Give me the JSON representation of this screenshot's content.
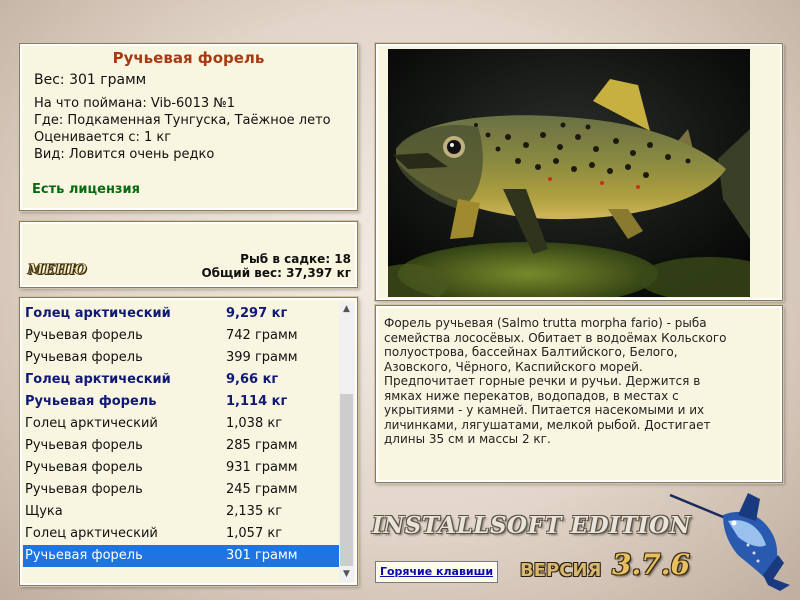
{
  "info": {
    "title": "Ручьевая форель",
    "weight": "Вес: 301 грамм",
    "caught_with": "На что поймана: Vib-6013 №1",
    "location": "Где: Подкаменная Тунгуска, Таёжное лето",
    "valued_from": "Оценивается с: 1 кг",
    "rarity": "Вид: Ловится очень редко",
    "license": "Есть лицензия"
  },
  "stats": {
    "menu_label": "МЕНЮ",
    "fish_count": "Рыб в садке: 18",
    "total_weight": "Общий вес: 37,397 кг"
  },
  "catch_list": [
    {
      "name": "Голец арктический",
      "weight": "9,297 кг",
      "highlight": true,
      "selected": false
    },
    {
      "name": "Ручьевая форель",
      "weight": "742 грамм",
      "highlight": false,
      "selected": false
    },
    {
      "name": "Ручьевая форель",
      "weight": "399 грамм",
      "highlight": false,
      "selected": false
    },
    {
      "name": "Голец арктический",
      "weight": "9,66 кг",
      "highlight": true,
      "selected": false
    },
    {
      "name": "Ручьевая форель",
      "weight": "1,114 кг",
      "highlight": true,
      "selected": false
    },
    {
      "name": "Голец арктический",
      "weight": "1,038 кг",
      "highlight": false,
      "selected": false
    },
    {
      "name": "Ручьевая форель",
      "weight": "285 грамм",
      "highlight": false,
      "selected": false
    },
    {
      "name": "Ручьевая форель",
      "weight": "931 грамм",
      "highlight": false,
      "selected": false
    },
    {
      "name": "Ручьевая форель",
      "weight": "245 грамм",
      "highlight": false,
      "selected": false
    },
    {
      "name": "Щука",
      "weight": "2,135 кг",
      "highlight": false,
      "selected": false
    },
    {
      "name": "Голец арктический",
      "weight": "1,057 кг",
      "highlight": false,
      "selected": false
    },
    {
      "name": "Ручьевая форель",
      "weight": "301 грамм",
      "highlight": false,
      "selected": true
    }
  ],
  "description": "Форель ручьевая (Salmo trutta morpha fario) - рыба семейства лососёвых. Обитает в водоёмах Кольского полуострова, бассейнах Балтийского, Белого, Азовского, Чёрного, Каспийского морей. Предпочитает горные речки и ручьи. Держится в ямках ниже перекатов, водопадов, в местах с укрытиями - у камней. Питается насекомыми и их личинками, лягушатами, мелкой рыбой. Достигает длины 35 см и массы 2 кг.",
  "footer": {
    "hotkeys_label": "Горячие клавиши",
    "edition": "INSTALLSOFT EDITION",
    "version_label": "ВЕРСИЯ",
    "version_number": "3.7.6"
  },
  "colors": {
    "title_red": "#a63a12",
    "license_green": "#0a6a14",
    "highlight_navy": "#101878",
    "selection_blue": "#1e74e0",
    "panel_bg": "#f8f6e0"
  },
  "icons": {
    "scroll_up": "scroll-up-arrow-icon",
    "scroll_down": "scroll-down-arrow-icon",
    "fish_photo": "brown-trout-photo",
    "logo": "marlin-logo"
  }
}
